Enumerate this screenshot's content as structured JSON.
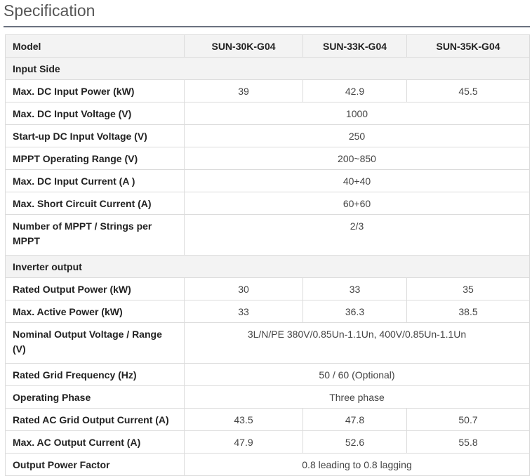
{
  "title": "Specification",
  "header": {
    "model": "Model",
    "col1": "SUN-30K-G04",
    "col2": "SUN-33K-G04",
    "col3": "SUN-35K-G04"
  },
  "sections": {
    "input": "Input Side",
    "output": "Inverter output"
  },
  "rows": {
    "max_dc_power": {
      "label": "Max. DC Input Power (kW)",
      "v1": "39",
      "v2": "42.9",
      "v3": "45.5"
    },
    "max_dc_voltage": {
      "label": "Max. DC Input Voltage (V)",
      "value": "1000"
    },
    "startup_voltage": {
      "label": "Start-up DC Input Voltage (V)",
      "value": "250"
    },
    "mppt_range": {
      "label": "MPPT Operating Range (V)",
      "value": "200~850"
    },
    "max_dc_current": {
      "label": "Max. DC Input Current (A )",
      "value": "40+40"
    },
    "short_circuit": {
      "label": "Max. Short Circuit Current (A)",
      "value": "60+60"
    },
    "mppt_strings": {
      "label": "Number of MPPT / Strings per MPPT",
      "value": "2/3"
    },
    "rated_output_power": {
      "label": "Rated Output Power (kW)",
      "v1": "30",
      "v2": "33",
      "v3": "35"
    },
    "max_active_power": {
      "label": "Max. Active Power (kW)",
      "v1": "33",
      "v2": "36.3",
      "v3": "38.5"
    },
    "nominal_voltage": {
      "label": "Nominal Output Voltage / Range (V)",
      "value": "3L/N/PE 380V/0.85Un-1.1Un, 400V/0.85Un-1.1Un"
    },
    "grid_frequency": {
      "label": "Rated Grid Frequency (Hz)",
      "value": "50 / 60 (Optional)"
    },
    "operating_phase": {
      "label": "Operating Phase",
      "value": "Three phase"
    },
    "rated_ac_current": {
      "label": "Rated AC Grid Output Current (A)",
      "v1": "43.5",
      "v2": "47.8",
      "v3": "50.7"
    },
    "max_ac_current": {
      "label": "Max. AC Output Current (A)",
      "v1": "47.9",
      "v2": "52.6",
      "v3": "55.8"
    },
    "power_factor": {
      "label": "Output Power Factor",
      "value": "0.8 leading to 0.8 lagging"
    }
  }
}
